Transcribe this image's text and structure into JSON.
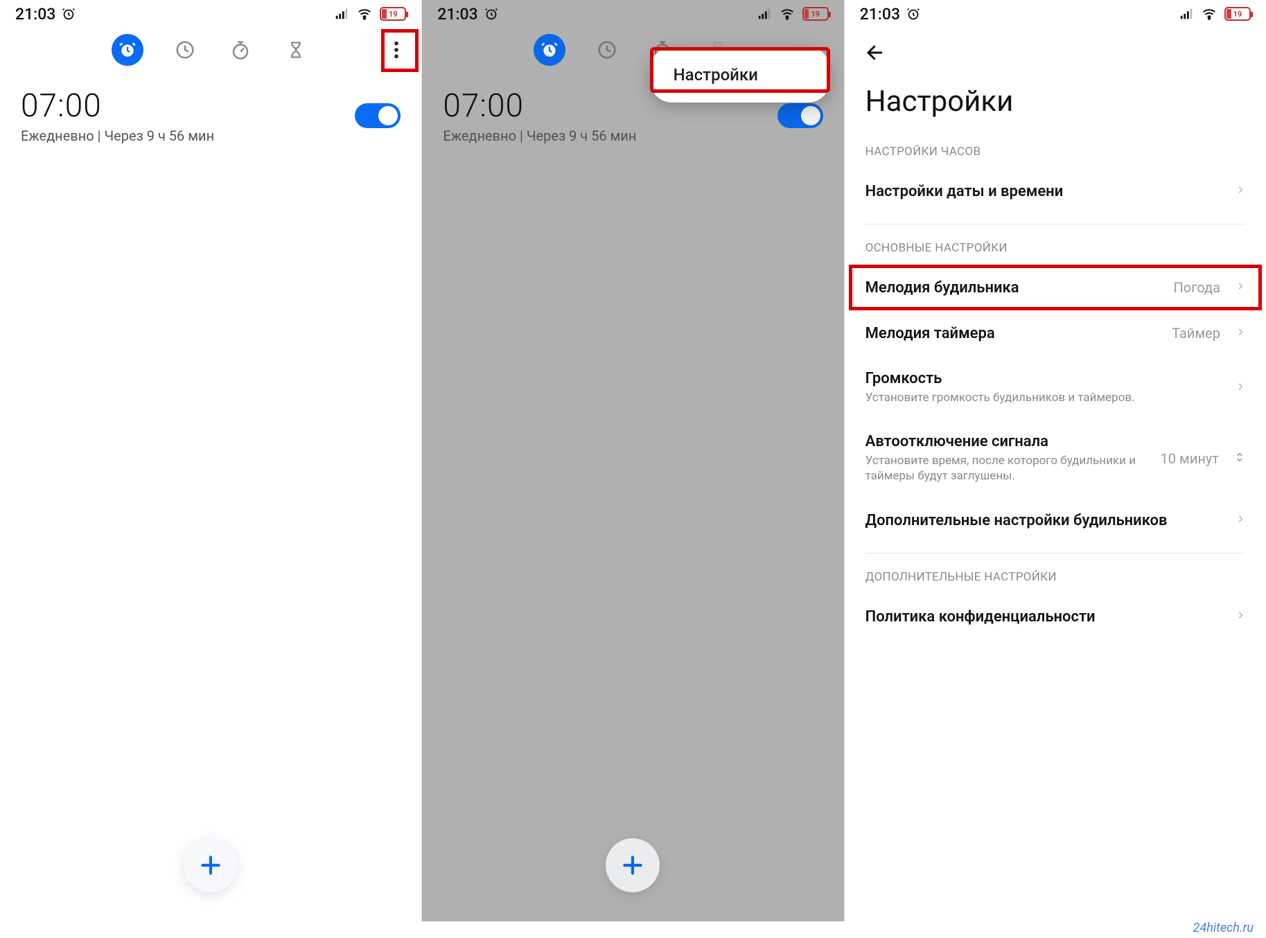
{
  "statusbar": {
    "time": "21:03",
    "battery": "19"
  },
  "tabs": {
    "alarm": "alarm",
    "clock": "clock",
    "stopwatch": "stopwatch",
    "timer": "timer"
  },
  "alarm": {
    "time": "07:00",
    "sub": "Ежедневно  |  Через 9 ч 56 мин"
  },
  "popup": {
    "settings": "Настройки"
  },
  "settings": {
    "title": "Настройки",
    "section_clock": "НАСТРОЙКИ ЧАСОВ",
    "datetime": "Настройки даты и времени",
    "section_main": "ОСНОВНЫЕ НАСТРОЙКИ",
    "alarm_melody": "Мелодия будильника",
    "alarm_melody_value": "Погода",
    "timer_melody": "Мелодия таймера",
    "timer_melody_value": "Таймер",
    "volume": "Громкость",
    "volume_sub": "Установите громкость будильников и таймеров.",
    "autooff": "Автоотключение сигнала",
    "autooff_sub": "Установите время, после которого будильники и таймеры будут заглушены.",
    "autooff_value": "10 минут",
    "extra_alarm": "Дополнительные настройки будильников",
    "section_extra": "ДОПОЛНИТЕЛЬНЫЕ НАСТРОЙКИ",
    "privacy": "Политика конфиденциальности"
  },
  "watermark": "24hitech.ru"
}
